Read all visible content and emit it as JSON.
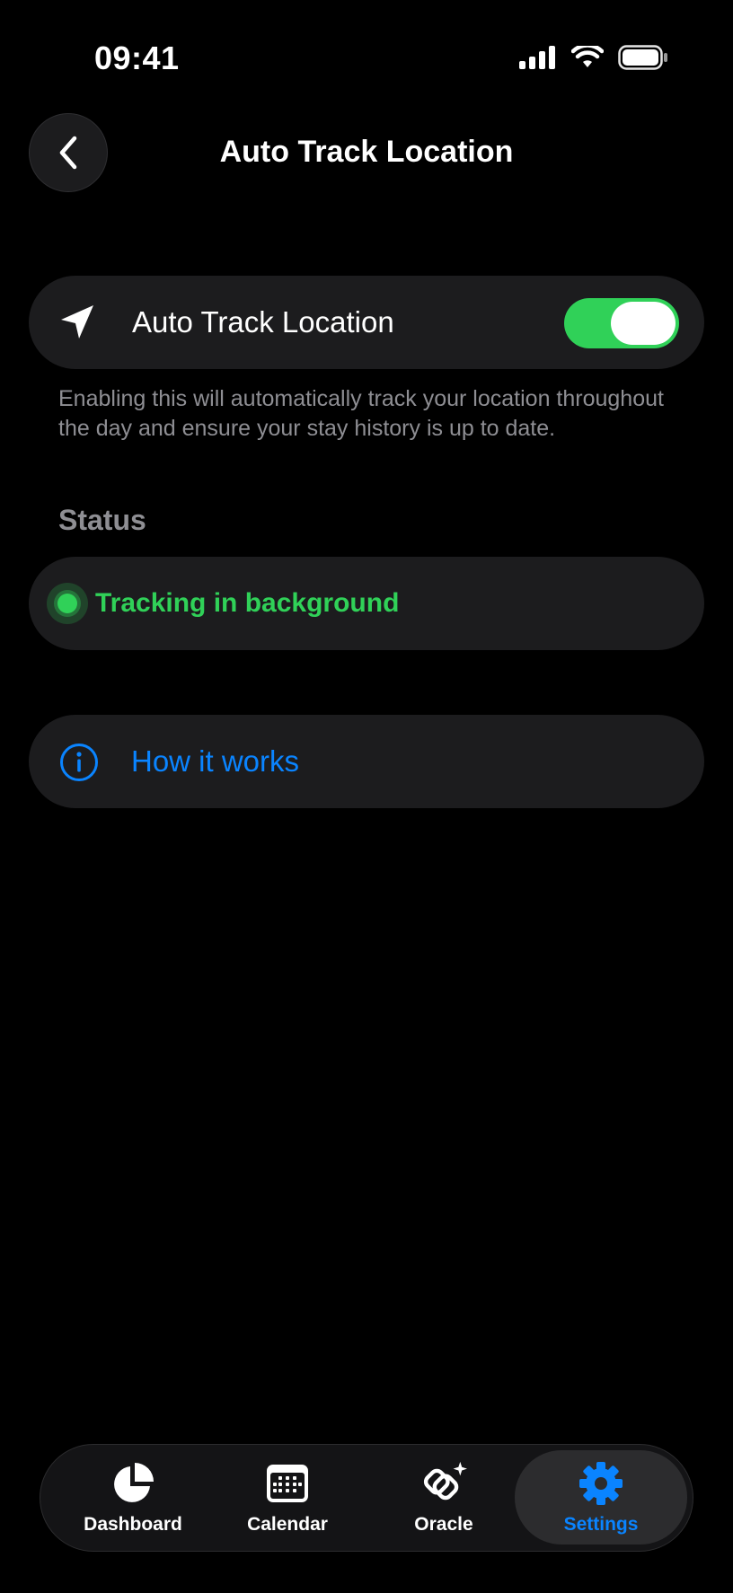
{
  "status_bar": {
    "time": "09:41"
  },
  "header": {
    "title": "Auto Track Location",
    "back_icon": "chevron-left-icon"
  },
  "toggle_row": {
    "icon": "location-arrow-icon",
    "label": "Auto Track Location",
    "enabled": true
  },
  "description": "Enabling this will automatically track your location throughout the day and ensure your stay history is up to date.",
  "status_section": {
    "label": "Status",
    "status_text": "Tracking in background"
  },
  "how_it_works": {
    "icon": "info-circle-icon",
    "label": "How it works"
  },
  "tab_bar": {
    "tabs": [
      {
        "label": "Dashboard",
        "icon": "pie-chart-icon",
        "active": false
      },
      {
        "label": "Calendar",
        "icon": "calendar-icon",
        "active": false
      },
      {
        "label": "Oracle",
        "icon": "oracle-sparkle-icon",
        "active": false
      },
      {
        "label": "Settings",
        "icon": "gear-icon",
        "active": true
      }
    ]
  },
  "colors": {
    "accent_blue": "#0a84ff",
    "accent_green": "#30d158",
    "card_bg": "#1c1c1e",
    "secondary_text": "#8e8e93"
  }
}
